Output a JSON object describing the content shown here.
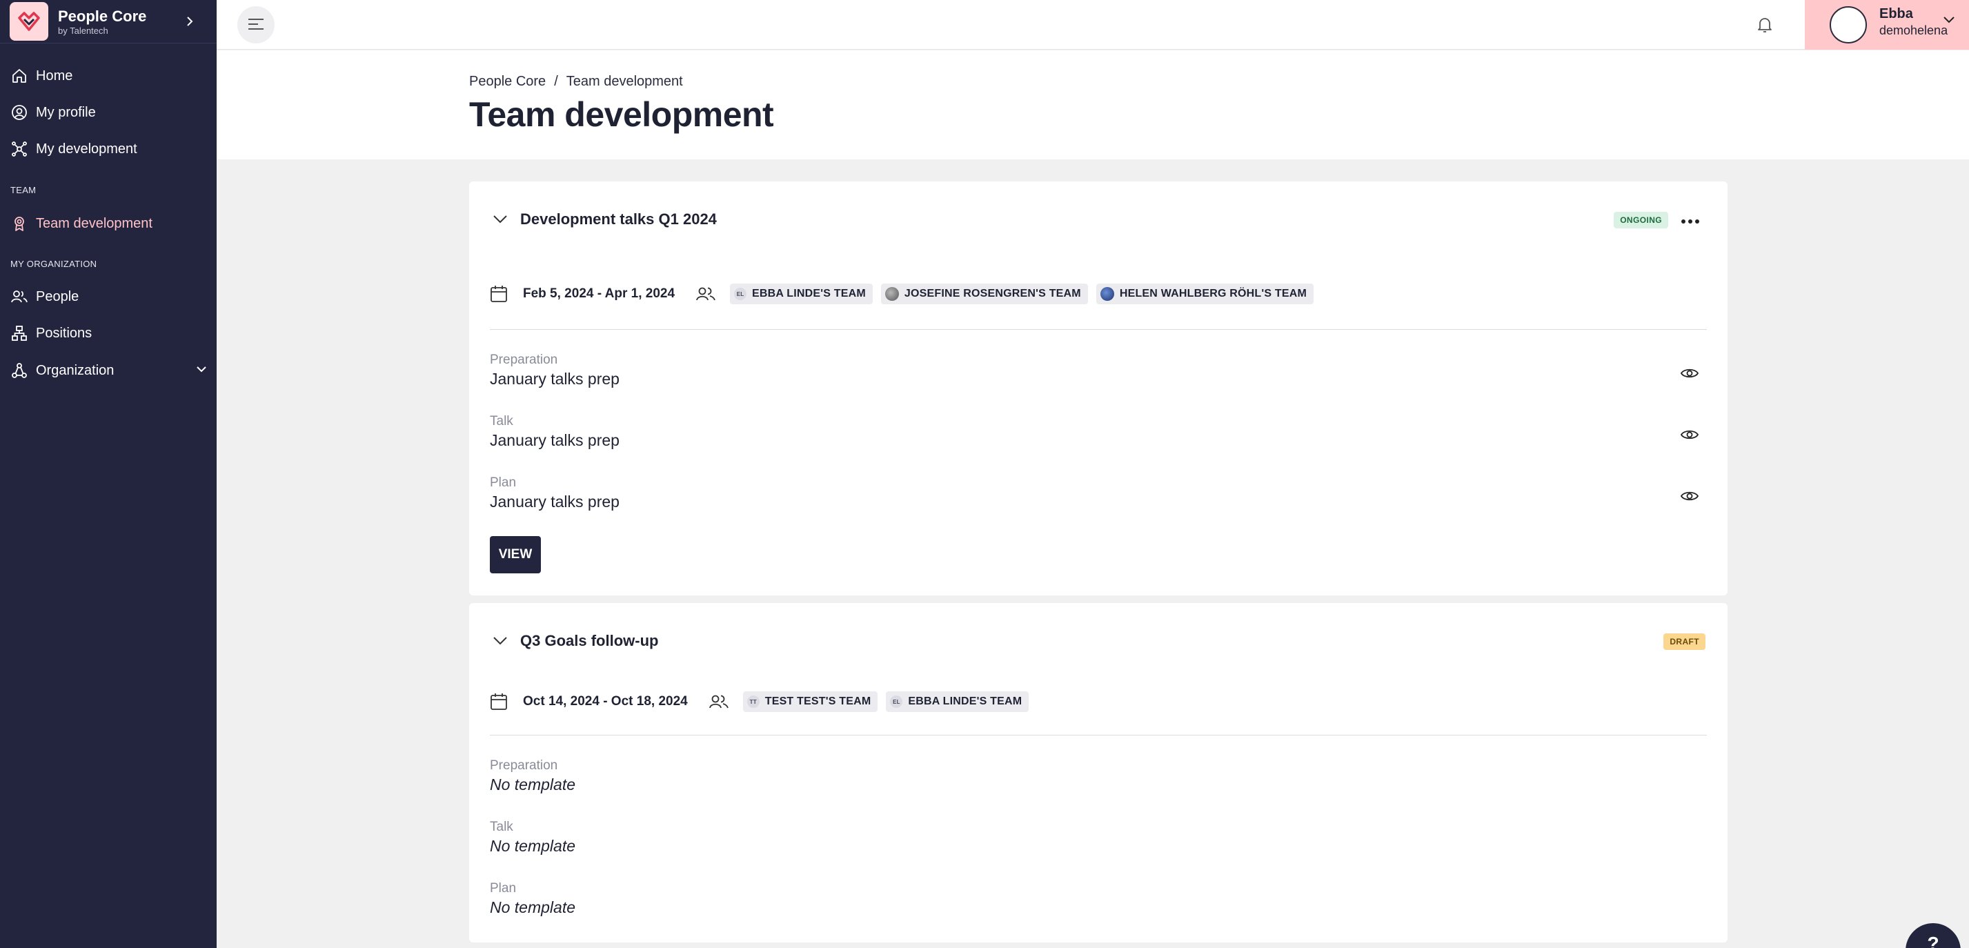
{
  "app": {
    "name": "People Core",
    "sub": "by Talentech",
    "colors": {
      "sidebar": "#23243e",
      "accent": "#ffc3c8",
      "user_bg": "#ffc9cc"
    }
  },
  "sidebar": {
    "items": [
      {
        "label": "Home",
        "icon": "home-icon"
      },
      {
        "label": "My profile",
        "icon": "user-circle-icon"
      },
      {
        "label": "My development",
        "icon": "network-icon"
      }
    ],
    "section_team": "TEAM",
    "team_items": [
      {
        "label": "Team development",
        "icon": "award-icon",
        "active": true
      }
    ],
    "section_org": "MY ORGANIZATION",
    "org_items": [
      {
        "label": "People",
        "icon": "people-icon"
      },
      {
        "label": "Positions",
        "icon": "org-chart-icon"
      },
      {
        "label": "Organization",
        "icon": "hierarchy-icon"
      }
    ]
  },
  "user": {
    "name": "Ebba",
    "login": "demohelena"
  },
  "header": {
    "breadcrumb": [
      "People Core",
      "Team development"
    ],
    "title": "Team development"
  },
  "cards": [
    {
      "title": "Development talks Q1 2024",
      "status": "ONGOING",
      "date_range": "Feb 5, 2024 - Apr 1, 2024",
      "teams": [
        {
          "initials": "EL",
          "name": "EBBA LINDE'S TEAM"
        },
        {
          "initials": "",
          "name": "JOSEFINE ROSENGREN'S TEAM"
        },
        {
          "initials": "",
          "name": "HELEN WAHLBERG RÖHL'S TEAM"
        }
      ],
      "steps": [
        {
          "label": "Preparation",
          "value": "January talks prep"
        },
        {
          "label": "Talk",
          "value": "January talks prep"
        },
        {
          "label": "Plan",
          "value": "January talks prep"
        }
      ],
      "view_label": "VIEW"
    },
    {
      "title": "Q3 Goals follow-up",
      "status": "DRAFT",
      "date_range": "Oct 14, 2024 - Oct 18, 2024",
      "teams": [
        {
          "initials": "TT",
          "name": "TEST TEST'S TEAM"
        },
        {
          "initials": "EL",
          "name": "EBBA LINDE'S TEAM"
        }
      ],
      "steps": [
        {
          "label": "Preparation",
          "value": "No template"
        },
        {
          "label": "Talk",
          "value": "No template"
        },
        {
          "label": "Plan",
          "value": "No template"
        }
      ]
    }
  ]
}
